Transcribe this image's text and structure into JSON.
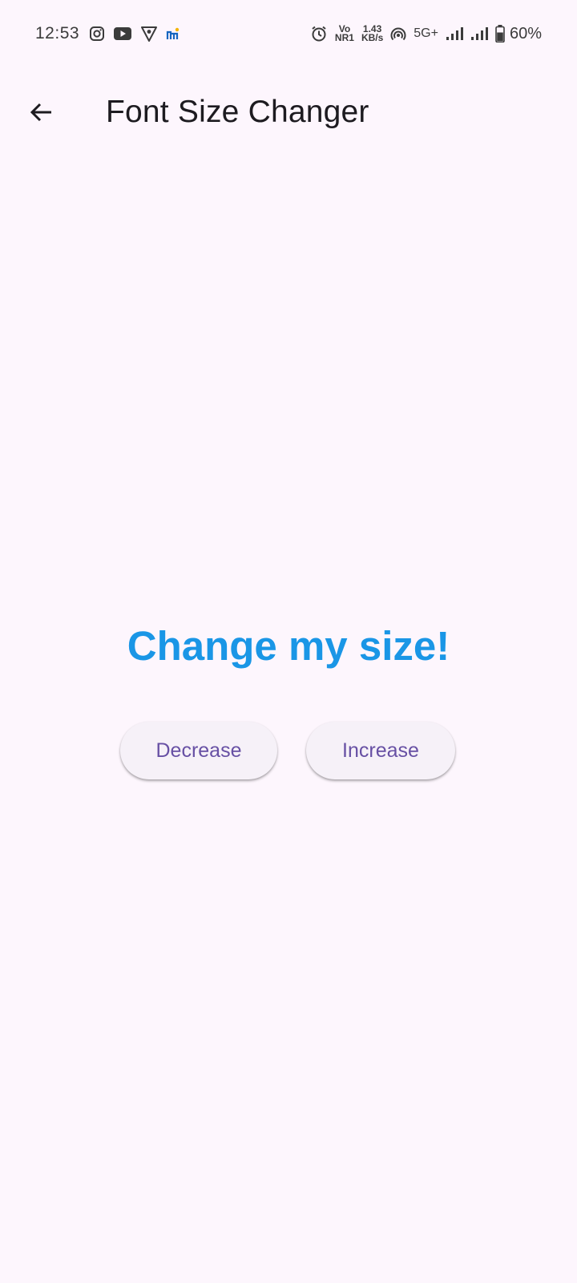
{
  "status_bar": {
    "time": "12:53",
    "app_icons": [
      "instagram-icon",
      "youtube-icon",
      "vpn-shield-icon",
      "app-m-icon"
    ],
    "volte_top": "Vo",
    "volte_bottom": "NR1",
    "speed_top": "1.43",
    "speed_bottom": "KB/s",
    "network": "5G+",
    "battery": "60%"
  },
  "app_bar": {
    "back_icon": "arrow-back-icon",
    "title": "Font Size Changer"
  },
  "main": {
    "headline": "Change my size!",
    "headline_color": "#1a96e6",
    "decrease_label": "Decrease",
    "increase_label": "Increase",
    "button_text_color": "#6750a4"
  },
  "colors": {
    "background": "#fdf6fd",
    "button_bg": "#f6f1f8"
  }
}
